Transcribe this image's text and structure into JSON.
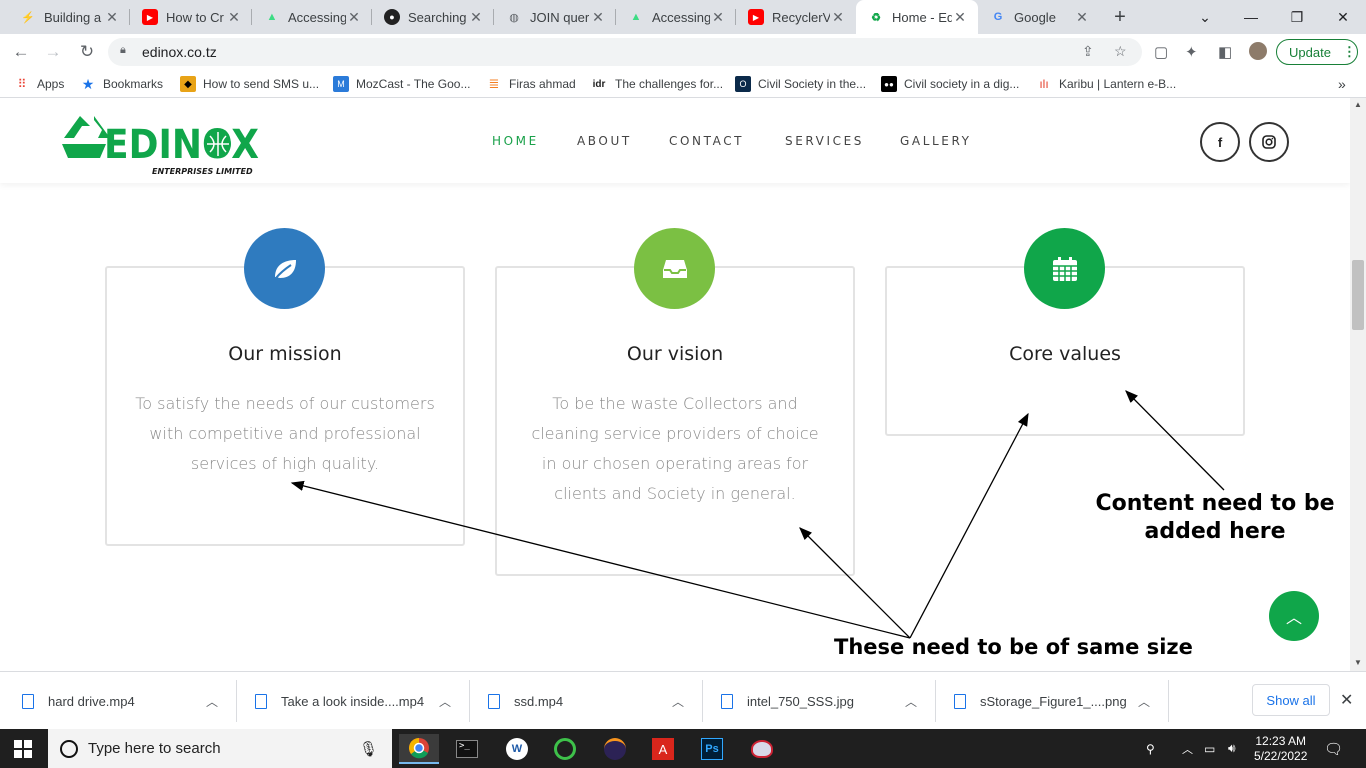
{
  "browser": {
    "tabs": [
      {
        "title": "Building a",
        "icon": "lightning-icon",
        "color": "#7b5cff"
      },
      {
        "title": "How to Cr",
        "icon": "youtube-icon",
        "color": "#ff0000"
      },
      {
        "title": "Accessing",
        "icon": "android-icon",
        "color": "#3ddc84"
      },
      {
        "title": "Searching",
        "icon": "github-icon",
        "color": "#222222"
      },
      {
        "title": "JOIN queri",
        "icon": "globe-icon",
        "color": "#5f6368"
      },
      {
        "title": "Accessing",
        "icon": "android-icon",
        "color": "#3ddc84"
      },
      {
        "title": "RecyclerVi",
        "icon": "youtube-icon",
        "color": "#ff0000"
      },
      {
        "title": "Home - Ed",
        "icon": "edinox-icon",
        "color": "#10a64a",
        "active": true
      },
      {
        "title": "Google",
        "icon": "google-icon",
        "color": "#4285f4"
      }
    ],
    "url": "edinox.co.tz",
    "update_label": "Update",
    "bookmarks": [
      {
        "label": "Apps",
        "icon": "apps-grid-icon"
      },
      {
        "label": "Bookmarks",
        "icon": "star-icon"
      },
      {
        "label": "How to send SMS u...",
        "icon": "site-icon"
      },
      {
        "label": "MozCast - The Goo...",
        "icon": "mozcast-icon"
      },
      {
        "label": "Firas ahmad",
        "icon": "stackoverflow-icon"
      },
      {
        "label": "The challenges for...",
        "icon": "idr-icon"
      },
      {
        "label": "Civil Society in the...",
        "icon": "site-icon"
      },
      {
        "label": "Civil society in a dig...",
        "icon": "medium-icon"
      },
      {
        "label": "Karibu | Lantern e-B...",
        "icon": "lantern-icon"
      }
    ],
    "bm_idr": "idr"
  },
  "site": {
    "logo_text": "EDINOX",
    "logo_sub": "ENTERPRISES LIMITED",
    "nav": [
      "HOME",
      "ABOUT",
      "CONTACT",
      "SERVICES",
      "GALLERY"
    ],
    "social_fb": "f",
    "social_ig": "instagram-icon",
    "cards": [
      {
        "title": "Our mission",
        "text": "To satisfy the needs of our customers with competitive and professional services of high quality.",
        "color": "#2f7bbf",
        "icon": "leaf-icon"
      },
      {
        "title": "Our vision",
        "text": "To be the waste Collectors and cleaning service providers of choice in our chosen operating areas for clients and Society in general.",
        "color": "#7bc043",
        "icon": "inbox-icon"
      },
      {
        "title": "Core values",
        "text": "",
        "color": "#10a64a",
        "icon": "calendar-icon"
      }
    ],
    "annotations": {
      "content_needed": "Content need to be added here",
      "same_size": "These need to be of same size"
    }
  },
  "downloads": {
    "items": [
      "hard drive.mp4",
      "Take a look inside....mp4",
      "ssd.mp4",
      "intel_750_SSS.jpg",
      "sStorage_Figure1_....png"
    ],
    "show_all": "Show all"
  },
  "taskbar": {
    "search_placeholder": "Type here to search",
    "time": "12:23 AM",
    "date": "5/22/2022"
  }
}
